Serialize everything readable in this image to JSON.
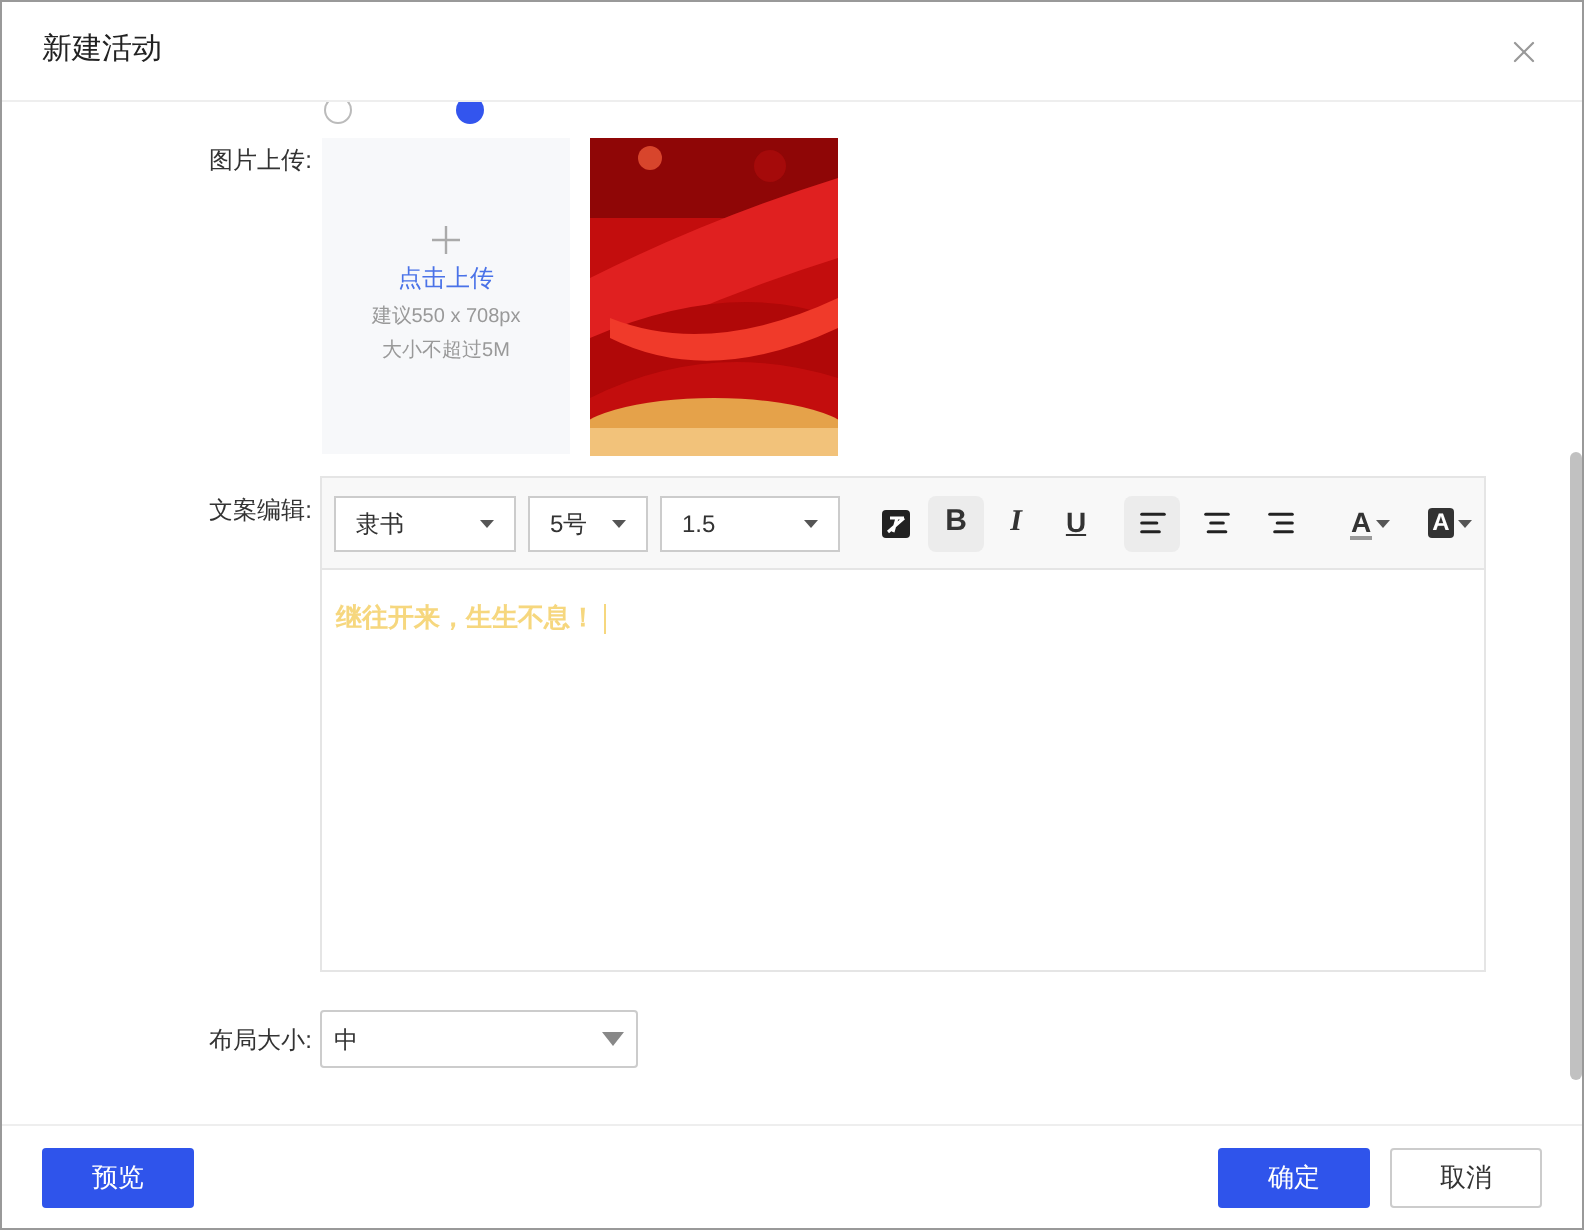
{
  "dialog": {
    "title": "新建活动"
  },
  "radios": [
    {
      "selected": false
    },
    {
      "selected": true
    }
  ],
  "upload": {
    "label": "图片上传:",
    "action": "点击上传",
    "hint": "建议550 x 708px",
    "limit": "大小不超过5M"
  },
  "editor": {
    "label": "文案编辑:",
    "selects": [
      {
        "value": "隶书"
      },
      {
        "value": "5号"
      },
      {
        "value": "1.5"
      }
    ],
    "buttons": [
      {
        "kind": "clear",
        "selected": false
      },
      {
        "kind": "bold",
        "label": "B",
        "selected": true
      },
      {
        "kind": "italic",
        "label": "I",
        "selected": false
      },
      {
        "kind": "underline",
        "label": "U",
        "selected": false
      },
      {
        "kind": "align-left",
        "selected": true
      },
      {
        "kind": "align-center",
        "selected": false
      },
      {
        "kind": "align-right",
        "selected": false
      },
      {
        "kind": "font-color",
        "label": "A",
        "selected": false
      },
      {
        "kind": "highlight",
        "label": "A",
        "selected": false
      }
    ],
    "content": "继往开来，生生不息！"
  },
  "layout": {
    "label": "布局大小:",
    "value": "中"
  },
  "footer": {
    "preview": "预览",
    "confirm": "确定",
    "cancel": "取消"
  }
}
